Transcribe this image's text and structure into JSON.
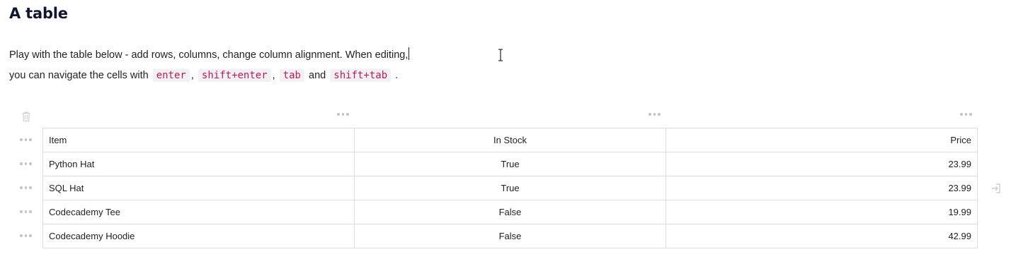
{
  "heading": "A table",
  "intro": {
    "line1": "Play with the table below - add rows, columns, change column alignment. When editing,",
    "line2_prefix": "you can navigate the cells with",
    "sep1": ",",
    "sep2": ",",
    "and_word": "and",
    "period": ".",
    "keys": [
      "enter",
      "shift+enter",
      "tab",
      "shift+tab"
    ]
  },
  "table": {
    "columns": [
      {
        "label": "Item",
        "align": "left"
      },
      {
        "label": "In Stock",
        "align": "center"
      },
      {
        "label": "Price",
        "align": "right"
      }
    ],
    "rows": [
      [
        "Python Hat",
        "True",
        "23.99"
      ],
      [
        "SQL Hat",
        "True",
        "23.99"
      ],
      [
        "Codecademy Tee",
        "False",
        "19.99"
      ],
      [
        "Codecademy Hoodie",
        "False",
        "42.99"
      ]
    ]
  },
  "icons": {
    "delete_table": "trash-icon",
    "column_handle": "more-horizontal-icon",
    "row_handle": "more-horizontal-icon",
    "add_column": "add-column-icon",
    "cursor": "text-cursor-icon"
  },
  "colors": {
    "code_text": "#c2185b",
    "code_bg": "#f1f1f3",
    "heading": "#10162f",
    "border": "#dcdcdc"
  }
}
